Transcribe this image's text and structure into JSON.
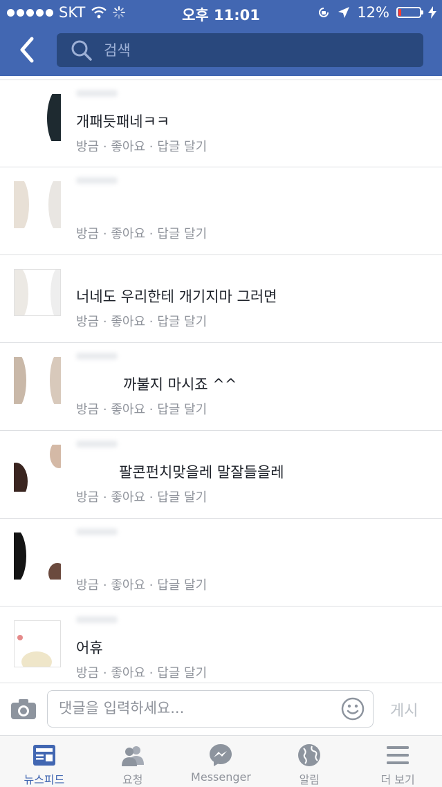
{
  "status_bar": {
    "carrier": "SKT",
    "time": "오후 11:01",
    "battery": "12%",
    "battery_level": 0.12
  },
  "header": {
    "search_placeholder": "검색"
  },
  "comments": [
    {
      "text": "개패듯패네ㅋㅋ",
      "time": "방금",
      "like": "좋아요",
      "reply": "답글 달기"
    },
    {
      "text": "",
      "time": "방금",
      "like": "좋아요",
      "reply": "답글 달기"
    },
    {
      "text": "너네도 우리한테 개기지마 그러면",
      "time": "방금",
      "like": "좋아요",
      "reply": "답글 달기"
    },
    {
      "text": "까불지 마시죠 ^^",
      "time": "방금",
      "like": "좋아요",
      "reply": "답글 달기"
    },
    {
      "text": "팔콘펀치맞을레 말잘들을레",
      "time": "방금",
      "like": "좋아요",
      "reply": "답글 달기"
    },
    {
      "text": "",
      "time": "방금",
      "like": "좋아요",
      "reply": "답글 달기"
    },
    {
      "text": "어휴",
      "time": "방금",
      "like": "좋아요",
      "reply": "답글 달기"
    }
  ],
  "meta_separator": "·",
  "composer": {
    "placeholder": "댓글을 입력하세요...",
    "post_label": "게시"
  },
  "tabbar": [
    {
      "label": "뉴스피드",
      "icon": "news-feed-icon",
      "active": true
    },
    {
      "label": "요청",
      "icon": "friend-requests-icon",
      "active": false
    },
    {
      "label": "Messenger",
      "icon": "messenger-icon",
      "active": false
    },
    {
      "label": "알림",
      "icon": "globe-icon",
      "active": false
    },
    {
      "label": "더 보기",
      "icon": "menu-icon",
      "active": false
    }
  ],
  "colors": {
    "brand": "#4267b2",
    "search_bg": "#29487d",
    "meta": "#90949c",
    "battery_low": "#ff3b30"
  }
}
